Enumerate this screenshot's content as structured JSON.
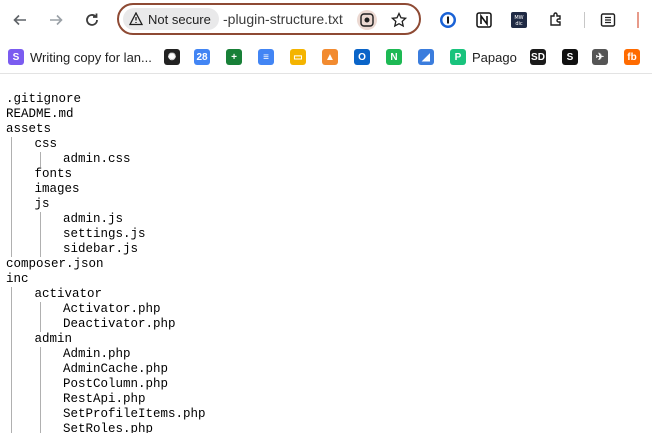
{
  "toolbar": {
    "back_icon": "arrow-left-icon",
    "forward_icon": "arrow-right-icon",
    "reload_icon": "reload-icon"
  },
  "omnibox": {
    "security_label": "Not secure",
    "url": "-plugin-structure.txt"
  },
  "bookmarks": [
    {
      "label": "Writing copy for lan...",
      "color": "#7b5cf0",
      "glyph": "S"
    },
    {
      "label": "",
      "color": "#222222",
      "glyph": "✺"
    },
    {
      "label": "",
      "color": "#4285f4",
      "glyph": "28"
    },
    {
      "label": "",
      "color": "#188038",
      "glyph": "+"
    },
    {
      "label": "",
      "color": "#4285f4",
      "glyph": "≡"
    },
    {
      "label": "",
      "color": "#f4b400",
      "glyph": "▭"
    },
    {
      "label": "",
      "color": "#f28b30",
      "glyph": "▲"
    },
    {
      "label": "",
      "color": "#0a64c8",
      "glyph": "O"
    },
    {
      "label": "",
      "color": "#1db954",
      "glyph": "N"
    },
    {
      "label": "",
      "color": "#3b7ddd",
      "glyph": "◢"
    },
    {
      "label": "Papago",
      "color": "#19c37d",
      "glyph": "P"
    },
    {
      "label": "",
      "color": "#1a1a1a",
      "glyph": "SD"
    },
    {
      "label": "",
      "color": "#111111",
      "glyph": "S"
    },
    {
      "label": "",
      "color": "#555555",
      "glyph": "✈"
    },
    {
      "label": "",
      "color": "#ff6b00",
      "glyph": "fb"
    }
  ],
  "tree": [
    {
      "name": ".gitignore",
      "depth": 0
    },
    {
      "name": "README.md",
      "depth": 0
    },
    {
      "name": "assets",
      "depth": 0
    },
    {
      "name": "css",
      "depth": 1
    },
    {
      "name": "admin.css",
      "depth": 2
    },
    {
      "name": "fonts",
      "depth": 1
    },
    {
      "name": "images",
      "depth": 1
    },
    {
      "name": "js",
      "depth": 1
    },
    {
      "name": "admin.js",
      "depth": 2
    },
    {
      "name": "settings.js",
      "depth": 2
    },
    {
      "name": "sidebar.js",
      "depth": 2
    },
    {
      "name": "composer.json",
      "depth": 0
    },
    {
      "name": "inc",
      "depth": 0
    },
    {
      "name": "activator",
      "depth": 1
    },
    {
      "name": "Activator.php",
      "depth": 2
    },
    {
      "name": "Deactivator.php",
      "depth": 2
    },
    {
      "name": "admin",
      "depth": 1
    },
    {
      "name": "Admin.php",
      "depth": 2
    },
    {
      "name": "AdminCache.php",
      "depth": 2
    },
    {
      "name": "PostColumn.php",
      "depth": 2
    },
    {
      "name": "RestApi.php",
      "depth": 2
    },
    {
      "name": "SetProfileItems.php",
      "depth": 2
    },
    {
      "name": "SetRoles.php",
      "depth": 2
    }
  ]
}
